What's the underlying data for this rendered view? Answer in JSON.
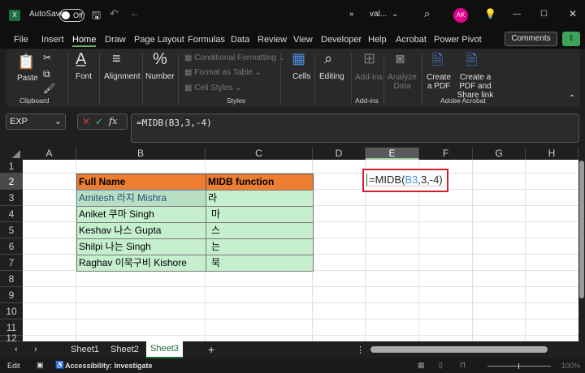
{
  "titlebar": {
    "autosave_label": "AutoSave",
    "autosave_state": "Off",
    "filename": "val...",
    "avatar_initials": "AK"
  },
  "menu_tabs": [
    {
      "label": "File"
    },
    {
      "label": "Insert"
    },
    {
      "label": "Home",
      "active": true
    },
    {
      "label": "Draw"
    },
    {
      "label": "Page Layout"
    },
    {
      "label": "Formulas"
    },
    {
      "label": "Data"
    },
    {
      "label": "Review"
    },
    {
      "label": "View"
    },
    {
      "label": "Developer"
    },
    {
      "label": "Help"
    },
    {
      "label": "Acrobat"
    },
    {
      "label": "Power Pivot"
    }
  ],
  "comments_label": "Comments",
  "ribbon": {
    "paste": "Paste",
    "clipboard": "Clipboard",
    "font": "Font",
    "alignment": "Alignment",
    "number": "Number",
    "conditional_formatting": "Conditional Formatting",
    "format_as_table": "Format as Table",
    "cell_styles": "Cell Styles",
    "styles": "Styles",
    "cells": "Cells",
    "editing": "Editing",
    "addins": "Add-ins",
    "addins_group": "Add-ins",
    "analyze_data": "Analyze Data",
    "create_pdf": "Create a PDF",
    "create_share": "Create a PDF and Share link",
    "adobe_group": "Adobe Acrobat"
  },
  "formula_bar": {
    "name_box": "EXP",
    "formula": "=MIDB(B3,3,-4)"
  },
  "columns": [
    "A",
    "B",
    "C",
    "D",
    "E",
    "F",
    "G",
    "H"
  ],
  "selected_column": "E",
  "rows": [
    "1",
    "2",
    "3",
    "4",
    "5",
    "6",
    "7",
    "8",
    "9",
    "10",
    "11",
    "12"
  ],
  "table": {
    "headers": [
      "Full Name",
      "MIDB function"
    ],
    "rows": [
      [
        "Amitesh 라지 Mishra",
        "라"
      ],
      [
        "Aniket 쿠마  Singh",
        "마"
      ],
      [
        "Keshav 나스 Gupta",
        "스"
      ],
      [
        "Shilpi 나는  Singh",
        "는"
      ],
      [
        "Raghav 이묵구비 Kishore",
        "묵"
      ]
    ]
  },
  "edit_cell": {
    "prefix": "=MIDB(",
    "ref": "B3",
    "suffix": ",3,-4)"
  },
  "colors": {
    "header": "#ed7d31",
    "data": "#c6efce",
    "highlight_box": "#d0202c",
    "ref": "#4a90d9"
  },
  "sheets": [
    {
      "label": "Sheet1"
    },
    {
      "label": "Sheet2"
    },
    {
      "label": "Sheet3",
      "active": true
    }
  ],
  "status": {
    "mode": "Edit",
    "accessibility": "Accessibility: Investigate",
    "zoom": "100%"
  }
}
